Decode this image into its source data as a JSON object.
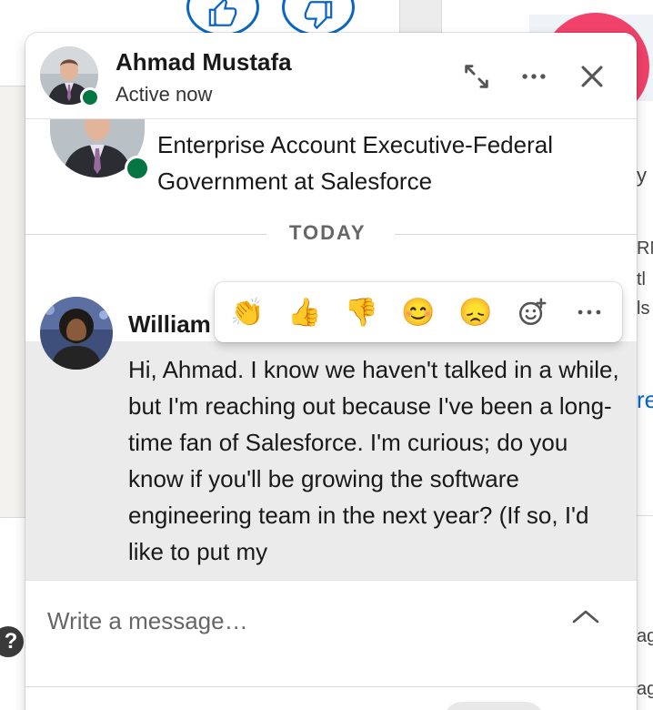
{
  "chat": {
    "header": {
      "name": "Ahmad Mustafa",
      "status": "Active now",
      "icons": [
        "expand-icon",
        "more-icon",
        "close-icon"
      ]
    },
    "profile": {
      "headline": "Enterprise Account Executive-Federal Government at Salesforce"
    },
    "divider": {
      "label": "TODAY"
    },
    "message": {
      "sender": "William",
      "body": "Hi, Ahmad. I know we haven't talked in a while, but I'm reaching out because I've been a long-time fan of Salesforce. I'm curious; do you know if you'll be growing the software engineering team in the next year? (If so, I'd like to put my"
    },
    "reactions": [
      {
        "name": "clapping-hands-reaction",
        "glyph": "👏"
      },
      {
        "name": "thumbs-up-reaction",
        "glyph": "👍"
      },
      {
        "name": "thumbs-down-reaction",
        "glyph": "👎"
      },
      {
        "name": "smiling-face-reaction",
        "glyph": "😊"
      },
      {
        "name": "disappointed-face-reaction",
        "glyph": "😞"
      },
      {
        "name": "add-reaction",
        "glyph": ""
      },
      {
        "name": "more-reactions",
        "glyph": ""
      }
    ],
    "compose": {
      "placeholder": "Write a message…"
    }
  },
  "background": {
    "help_glyph": "?",
    "right_fragments": [
      "y",
      "RM",
      "tl",
      "ls",
      "re",
      "ag",
      "ag"
    ]
  },
  "colors": {
    "brand_blue": "#0a66c2",
    "presence_green": "#057642",
    "hover_gray": "#ebebeb"
  }
}
